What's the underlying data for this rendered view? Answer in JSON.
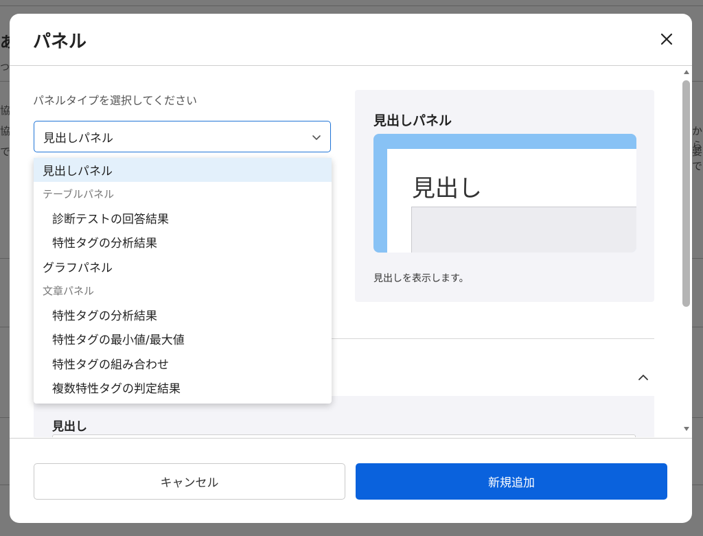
{
  "background": {
    "title_fragment": "あ",
    "subtitle_fragment": "つ",
    "left_fragments": [
      "協",
      "協",
      "で"
    ],
    "right_fragments": [
      "から",
      "要で"
    ]
  },
  "modal": {
    "title": "パネル",
    "panel_type_label": "パネルタイプを選択してください",
    "selected_value": "見出しパネル",
    "options": [
      {
        "label": "見出しパネル",
        "kind": "item",
        "selected": true
      },
      {
        "label": "テーブルパネル",
        "kind": "group"
      },
      {
        "label": "診断テストの回答結果",
        "kind": "subitem"
      },
      {
        "label": "特性タグの分析結果",
        "kind": "subitem"
      },
      {
        "label": "グラフパネル",
        "kind": "item"
      },
      {
        "label": "文章パネル",
        "kind": "group"
      },
      {
        "label": "特性タグの分析結果",
        "kind": "subitem"
      },
      {
        "label": "特性タグの最小値/最大値",
        "kind": "subitem"
      },
      {
        "label": "特性タグの組み合わせ",
        "kind": "subitem"
      },
      {
        "label": "複数特性タグの判定結果",
        "kind": "subitem"
      }
    ],
    "preview": {
      "title": "見出しパネル",
      "heading_sample": "見出し",
      "description": "見出しを表示します。"
    },
    "section": {
      "label": "見出し"
    },
    "footer": {
      "cancel_label": "キャンセル",
      "submit_label": "新規追加"
    }
  },
  "colors": {
    "primary": "#0a62dd",
    "focus_border": "#1e73d6",
    "selected_option_bg": "#e3f0fb",
    "preview_accent": "#88c2f5"
  }
}
